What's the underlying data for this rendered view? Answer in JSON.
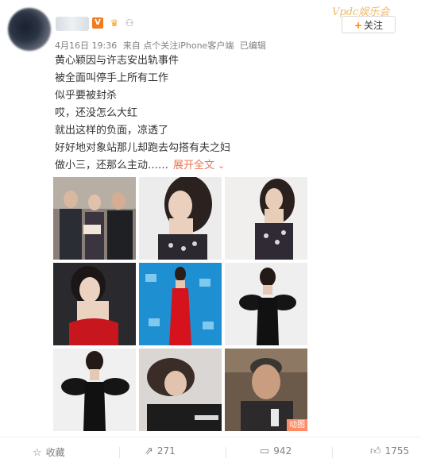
{
  "header": {
    "watermark": "Vpdc娱乐会",
    "follow_label": "关注",
    "follow_plus": "+",
    "badges": {
      "verified": "V",
      "crown_icon": "crown-icon",
      "gift_icon": "gift-icon"
    }
  },
  "meta": {
    "date": "4月16日 19:36",
    "source": "来自 点个关注iPhone客户端",
    "edited": "已编辑"
  },
  "post": {
    "lines": [
      "黄心颖因与许志安出轨事件",
      "被全面叫停手上所有工作",
      "似乎要被封杀",
      "哎，还没怎么大红",
      "就出这样的负面，凉透了",
      "好好地对象站那儿却跑去勾搭有夫之妇",
      "做小三，还那么主动……"
    ],
    "expand_label": "展开全文",
    "expand_chevron": "⌄"
  },
  "images": {
    "gif_label": "动图"
  },
  "actions": {
    "favorite_label": "收藏",
    "repost_count": "271",
    "comment_count": "942",
    "like_count": "1755"
  },
  "colors": {
    "accent_orange": "#ff8200",
    "link": "#eb7350",
    "meta_gray": "#808080"
  }
}
